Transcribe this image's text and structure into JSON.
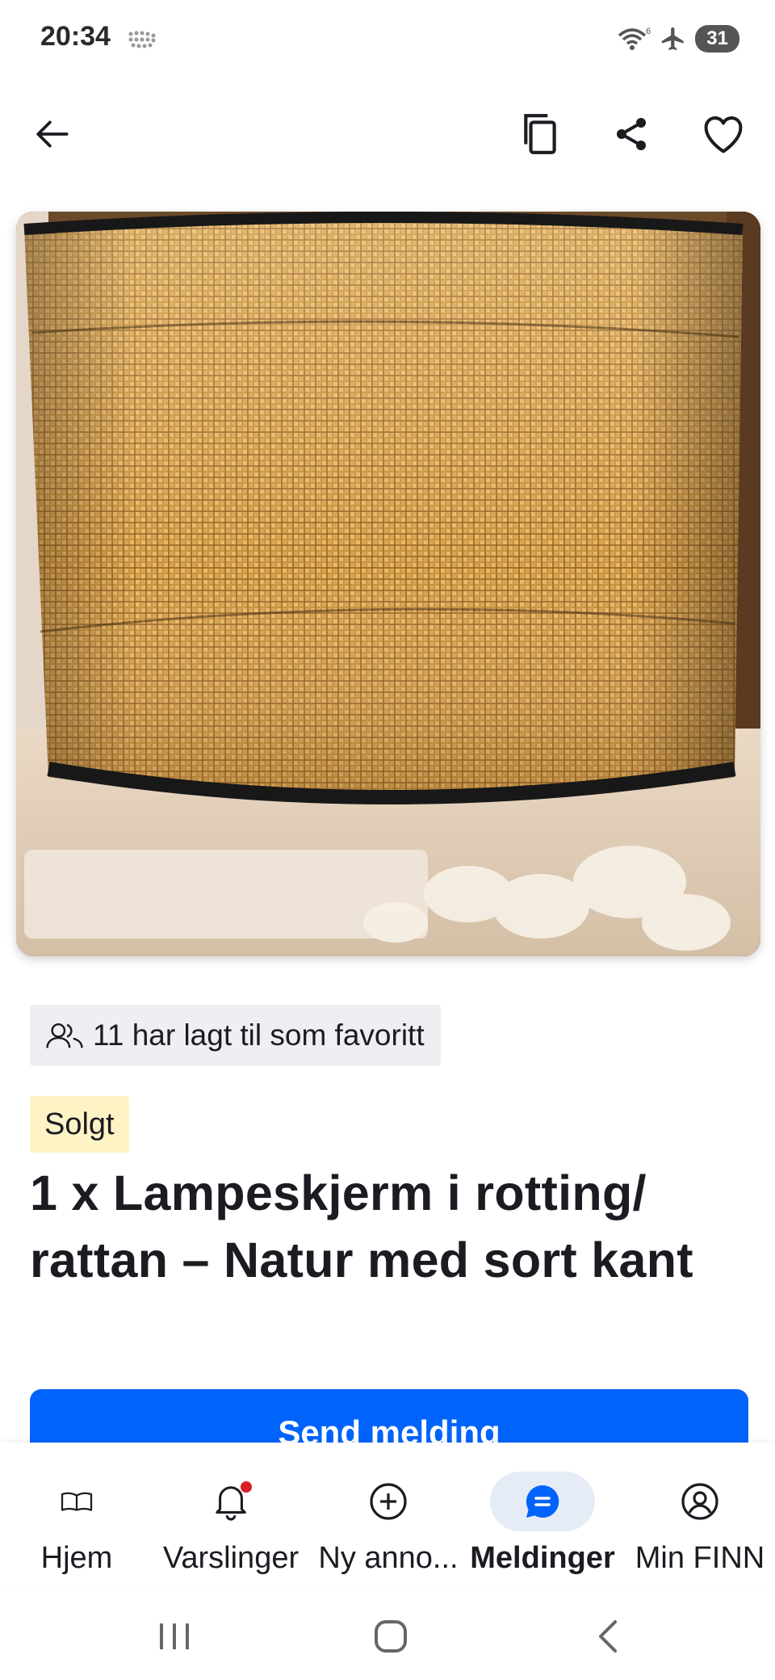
{
  "status_bar": {
    "time": "20:34",
    "battery": "31",
    "network_badge": "6"
  },
  "topbar": {
    "back_icon": "arrow-left-icon",
    "copy_icon": "copy-icon",
    "share_icon": "share-icon",
    "favorite_icon": "heart-icon"
  },
  "listing": {
    "image_alt": "Lampeskjerm i rotting",
    "favorites_text": "11 har lagt til som favoritt",
    "status_badge": "Solgt",
    "title": "1 x Lampeskjerm i rotting/ rattan – Natur med sort kant",
    "cta_label": "Send melding"
  },
  "bottom_nav": {
    "items": [
      {
        "label": "Hjem",
        "icon": "book-icon",
        "active": false
      },
      {
        "label": "Varslinger",
        "icon": "bell-icon",
        "active": false,
        "has_notification": true
      },
      {
        "label": "Ny anno...",
        "icon": "plus-circle-icon",
        "active": false
      },
      {
        "label": "Meldinger",
        "icon": "chat-icon",
        "active": true
      },
      {
        "label": "Min FINN",
        "icon": "user-circle-icon",
        "active": false
      }
    ]
  },
  "colors": {
    "primary": "#0063fb",
    "sold_badge": "#fdf3c5",
    "chip_bg": "#eeeff2",
    "active_nav_bg": "#e6ecf6",
    "notification": "#d91f26"
  }
}
